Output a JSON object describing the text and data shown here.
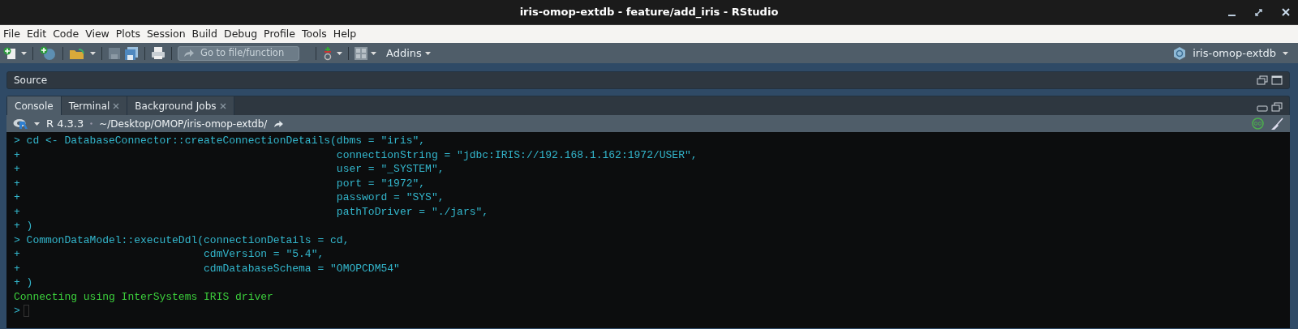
{
  "window": {
    "title": "iris-omop-extdb - feature/add_iris - RStudio"
  },
  "menu": [
    "File",
    "Edit",
    "Code",
    "View",
    "Plots",
    "Session",
    "Build",
    "Debug",
    "Profile",
    "Tools",
    "Help"
  ],
  "toolbar": {
    "goto": {
      "placeholder": "Go to file/function"
    },
    "addins": "Addins",
    "project": "iris-omop-extdb"
  },
  "source_pane": {
    "title": "Source"
  },
  "console_tabs": [
    {
      "label": "Console",
      "selected": true,
      "closable": false
    },
    {
      "label": "Terminal",
      "selected": false,
      "closable": true
    },
    {
      "label": "Background Jobs",
      "selected": false,
      "closable": true
    }
  ],
  "console_bar": {
    "version": "R 4.3.3",
    "path": "~/Desktop/OMOP/iris-omop-extdb/"
  },
  "console_lines": [
    {
      "kind": "input",
      "prompt": ">",
      "text": "cd <- DatabaseConnector::createConnectionDetails(dbms = \"iris\","
    },
    {
      "kind": "input",
      "prompt": "+",
      "text": "                                                 connectionString = \"jdbc:IRIS://192.168.1.162:1972/USER\","
    },
    {
      "kind": "input",
      "prompt": "+",
      "text": "                                                 user = \"_SYSTEM\","
    },
    {
      "kind": "input",
      "prompt": "+",
      "text": "                                                 port = \"1972\","
    },
    {
      "kind": "input",
      "prompt": "+",
      "text": "                                                 password = \"SYS\","
    },
    {
      "kind": "input",
      "prompt": "+",
      "text": "                                                 pathToDriver = \"./jars\","
    },
    {
      "kind": "input",
      "prompt": "+",
      "text": ")"
    },
    {
      "kind": "input",
      "prompt": ">",
      "text": "CommonDataModel::executeDdl(connectionDetails = cd,"
    },
    {
      "kind": "input",
      "prompt": "+",
      "text": "                            cdmVersion = \"5.4\","
    },
    {
      "kind": "input",
      "prompt": "+",
      "text": "                            cdmDatabaseSchema = \"OMOPCDM54\""
    },
    {
      "kind": "input",
      "prompt": "+",
      "text": ")"
    },
    {
      "kind": "output",
      "text": "Connecting using InterSystems IRIS driver"
    },
    {
      "kind": "prompt",
      "prompt": ">"
    }
  ]
}
